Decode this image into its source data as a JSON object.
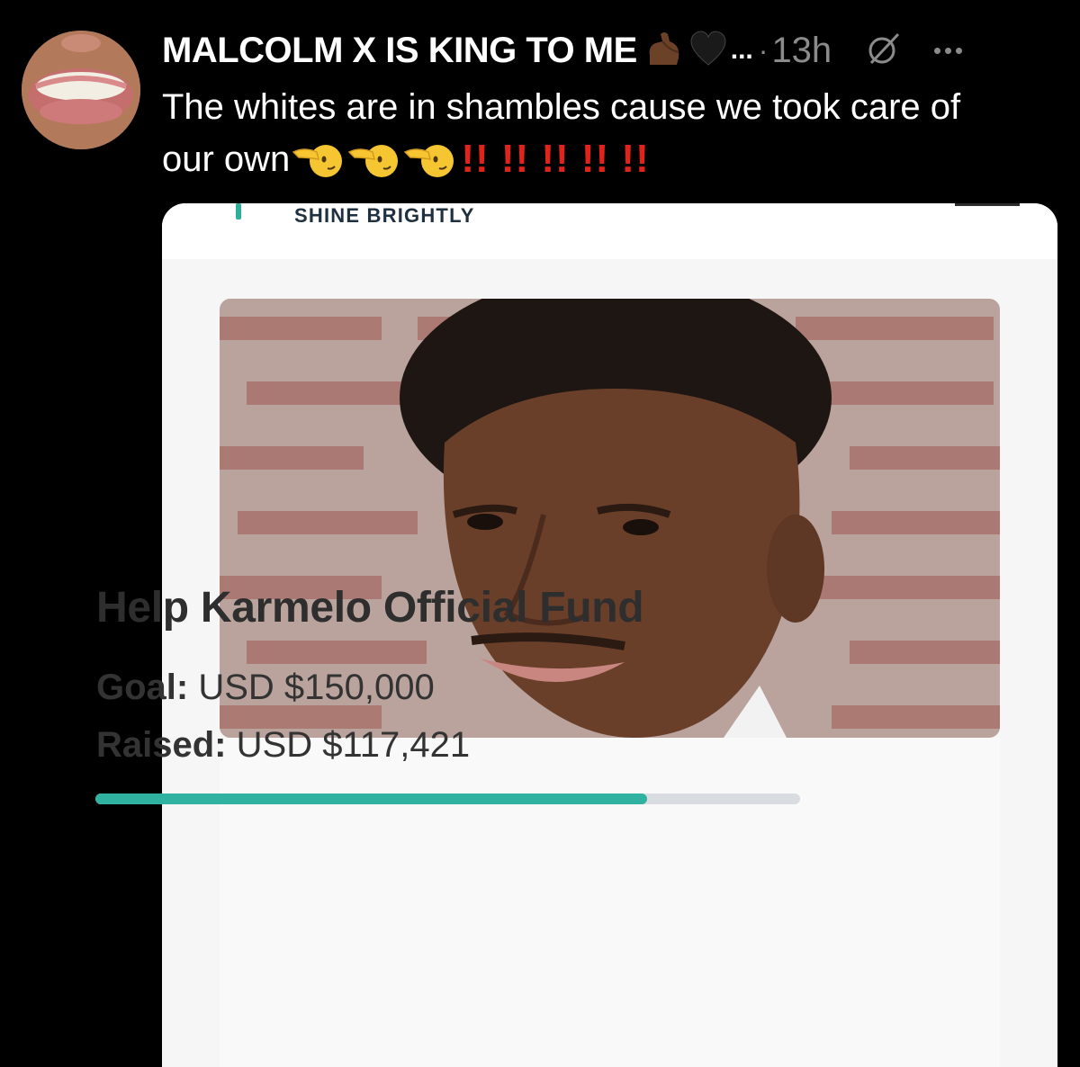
{
  "post": {
    "author_name": "MALCOLM X IS KING TO ME",
    "name_emojis": [
      "flexed-biceps-icon",
      "black-heart-icon"
    ],
    "name_truncation": "...",
    "separator": "·",
    "timestamp": "13h",
    "text_line1": "The whites are in shambles cause we took care of",
    "text_line2": "our own",
    "bangs": "!! !! !! !! !!",
    "trailing_emojis": [
      "pointing-left-face-icon",
      "pointing-left-face-icon",
      "pointing-left-face-icon"
    ]
  },
  "card": {
    "tagline": "SHINE BRIGHTLY",
    "fund_title": "Help Karmelo Official Fund",
    "goal_label": "Goal:",
    "goal_value": "USD $150,000",
    "raised_label": "Raised:",
    "raised_value": "USD $117,421",
    "progress_fraction": 0.783,
    "accent_color": "#2fb3a0"
  }
}
